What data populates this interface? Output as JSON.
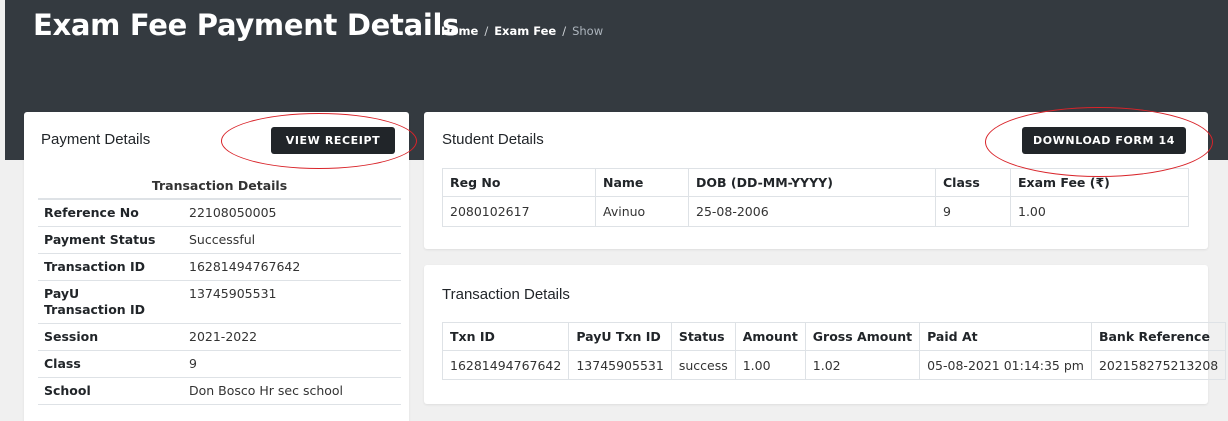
{
  "header": {
    "title": "Exam Fee Payment Details",
    "breadcrumb": [
      "Home",
      "Exam Fee",
      "Show"
    ]
  },
  "payment_card": {
    "title": "Payment Details",
    "button": "VIEW RECEIPT",
    "table_caption": "Transaction Details",
    "rows": [
      {
        "key": "Reference No",
        "value": "22108050005"
      },
      {
        "key": "Payment Status",
        "value": "Successful"
      },
      {
        "key": "Transaction ID",
        "value": "16281494767642"
      },
      {
        "key": "PayU Transaction ID",
        "value": "13745905531"
      },
      {
        "key": "Session",
        "value": "2021-2022"
      },
      {
        "key": "Class",
        "value": "9"
      },
      {
        "key": "School",
        "value": "Don Bosco Hr sec school"
      }
    ]
  },
  "student_card": {
    "title": "Student Details",
    "button": "DOWNLOAD FORM 14",
    "headers": [
      "Reg No",
      "Name",
      "DOB (DD-MM-YYYY)",
      "Class",
      "Exam Fee (₹)"
    ],
    "row": [
      "2080102617",
      "Avinuo",
      "25-08-2006",
      "9",
      "1.00"
    ]
  },
  "txn_card": {
    "title": "Transaction Details",
    "headers": [
      "Txn ID",
      "PayU Txn ID",
      "Status",
      "Amount",
      "Gross Amount",
      "Paid At",
      "Bank Reference"
    ],
    "row": [
      "16281494767642",
      "13745905531",
      "success",
      "1.00",
      "1.02",
      "05-08-2021 01:14:35 pm",
      "202158275213208"
    ]
  },
  "colors": {
    "header_bg": "#343a40",
    "button_bg": "#212529",
    "annotation": "#d9242a"
  }
}
